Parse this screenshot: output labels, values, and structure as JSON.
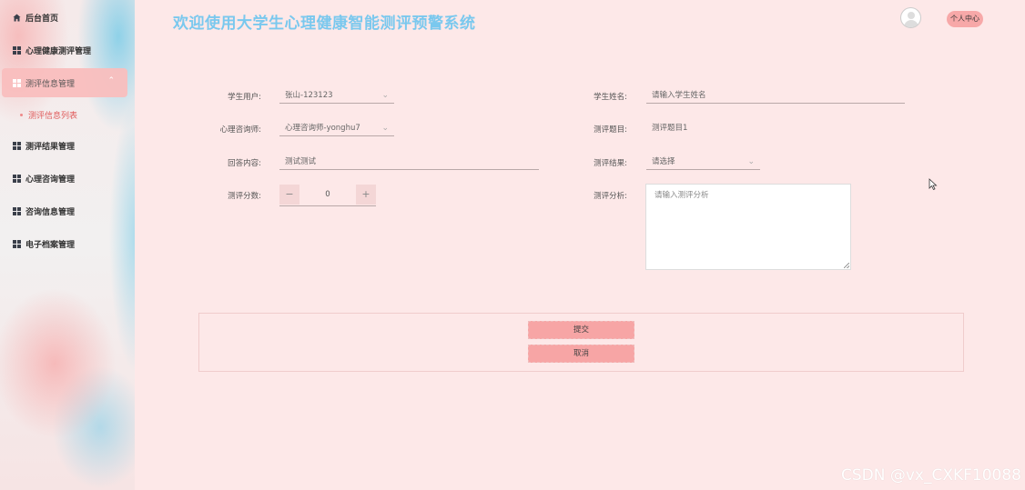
{
  "header": {
    "title": "欢迎使用大学生心理健康智能测评预警系统",
    "profile_label": "个人中心"
  },
  "sidebar": {
    "items": [
      {
        "label": "后台首页",
        "icon": "home-icon"
      },
      {
        "label": "心理健康测评管理",
        "icon": "grid-icon"
      },
      {
        "label": "测评信息管理",
        "icon": "grid-icon",
        "active": true,
        "expanded": true
      },
      {
        "label": "测评结果管理",
        "icon": "grid-icon"
      },
      {
        "label": "心理咨询管理",
        "icon": "grid-icon"
      },
      {
        "label": "咨询信息管理",
        "icon": "grid-icon"
      },
      {
        "label": "电子档案管理",
        "icon": "grid-icon"
      }
    ],
    "submenu": {
      "label": "测评信息列表"
    }
  },
  "form": {
    "student_user": {
      "label": "学生用户:",
      "value": "张山-123123"
    },
    "student_name": {
      "label": "学生姓名:",
      "placeholder": "请输入学生姓名"
    },
    "counselor": {
      "label": "心理咨询师:",
      "value": "心理咨询师-yonghu7"
    },
    "question": {
      "label": "测评题目:",
      "value": "测评题目1"
    },
    "answer": {
      "label": "回答内容:",
      "value": "测试测试"
    },
    "result": {
      "label": "测评结果:",
      "placeholder": "请选择"
    },
    "score": {
      "label": "测评分数:",
      "value": "0",
      "minus": "−",
      "plus": "+"
    },
    "analysis": {
      "label": "测评分析:",
      "placeholder": "请输入测评分析"
    }
  },
  "actions": {
    "submit": "提交",
    "cancel": "取消"
  },
  "watermark": "CSDN @vx_CXKF10088"
}
